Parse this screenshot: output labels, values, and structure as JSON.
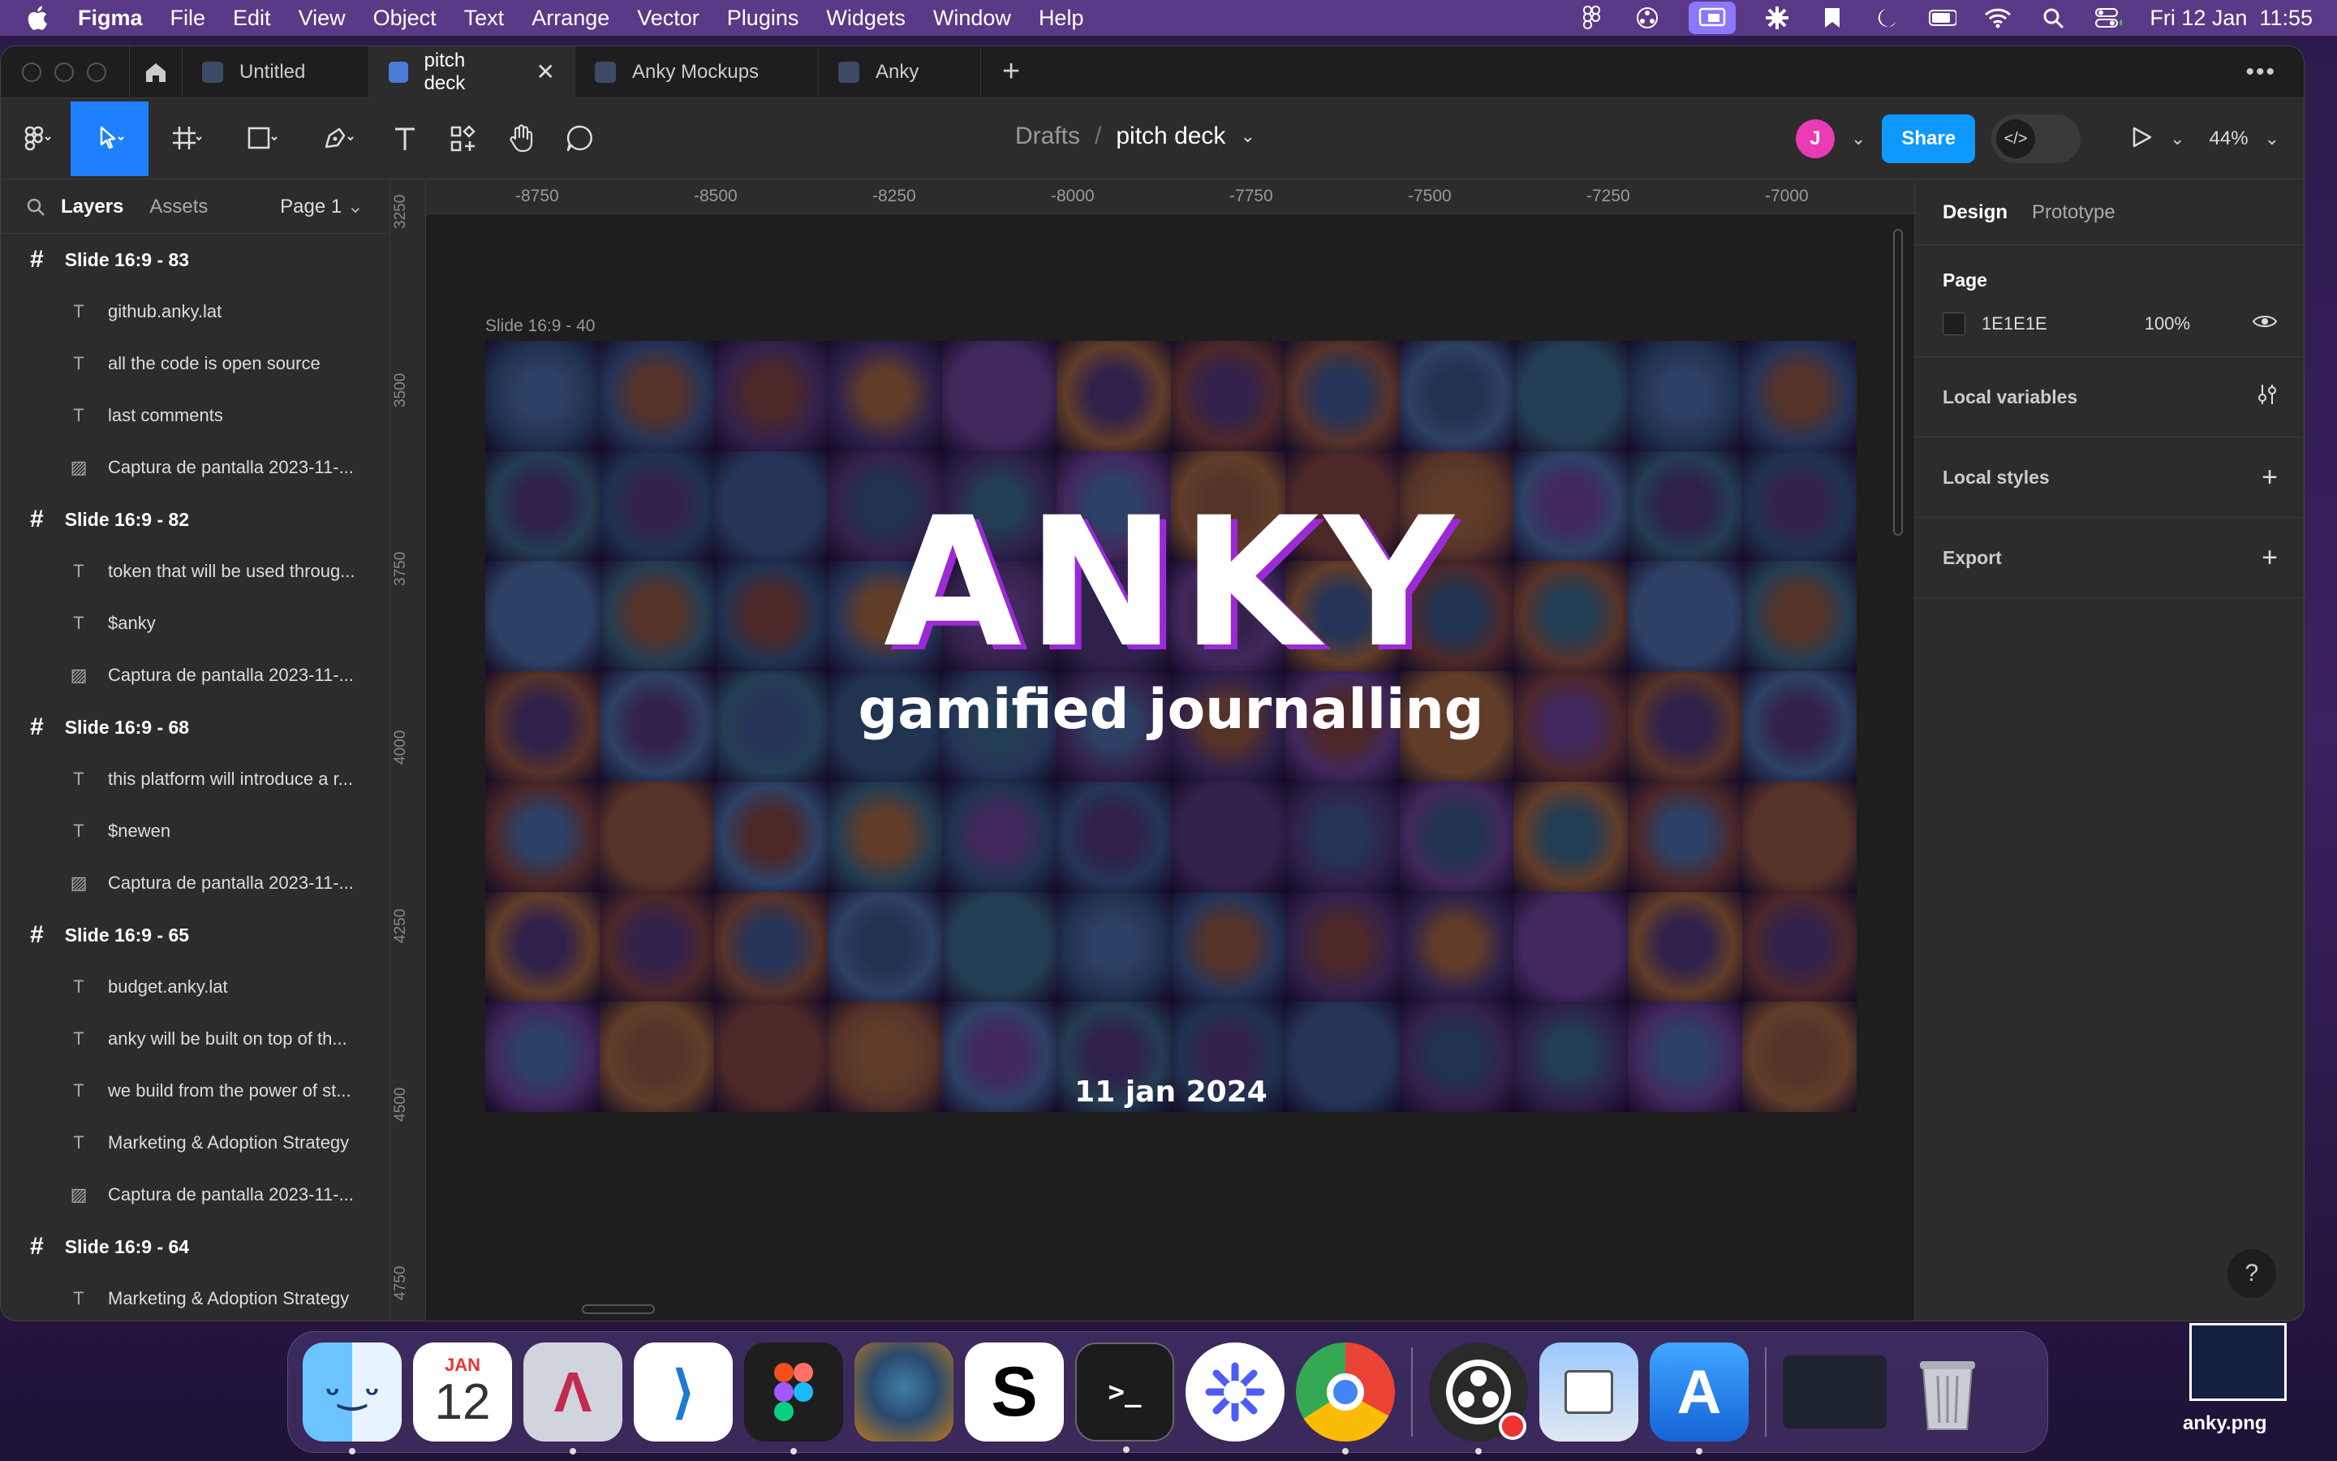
{
  "menubar": {
    "app": "Figma",
    "items": [
      "File",
      "Edit",
      "View",
      "Object",
      "Text",
      "Arrange",
      "Vector",
      "Plugins",
      "Widgets",
      "Window",
      "Help"
    ],
    "datetime": "Fri 12 Jan  11:55"
  },
  "tabs": [
    {
      "label": "Untitled"
    },
    {
      "label": "pitch deck"
    },
    {
      "label": "Anky Mockups"
    },
    {
      "label": "Anky"
    }
  ],
  "toolbar": {
    "breadcrumb_root": "Drafts",
    "breadcrumb_sep": "/",
    "file_name": "pitch deck",
    "avatar_initial": "J",
    "share_label": "Share",
    "zoom": "44%"
  },
  "layers_panel": {
    "tab_layers": "Layers",
    "tab_assets": "Assets",
    "page": "Page 1",
    "items": [
      {
        "type": "frame",
        "label": "Slide 16:9 - 83"
      },
      {
        "type": "text",
        "label": "github.anky.lat"
      },
      {
        "type": "text",
        "label": "all the code is open source"
      },
      {
        "type": "text",
        "label": "last comments"
      },
      {
        "type": "image",
        "label": "Captura de pantalla 2023-11-..."
      },
      {
        "type": "frame",
        "label": "Slide 16:9 - 82"
      },
      {
        "type": "text",
        "label": "token that will be used throug..."
      },
      {
        "type": "text",
        "label": "$anky"
      },
      {
        "type": "image",
        "label": "Captura de pantalla 2023-11-..."
      },
      {
        "type": "frame",
        "label": "Slide 16:9 - 68"
      },
      {
        "type": "text",
        "label": "this platform will introduce a r..."
      },
      {
        "type": "text",
        "label": "$newen"
      },
      {
        "type": "image",
        "label": "Captura de pantalla 2023-11-..."
      },
      {
        "type": "frame",
        "label": "Slide 16:9 - 65"
      },
      {
        "type": "text",
        "label": "budget.anky.lat"
      },
      {
        "type": "text",
        "label": "anky will be built on top of th..."
      },
      {
        "type": "text",
        "label": "we build from the power of st..."
      },
      {
        "type": "text",
        "label": "Marketing & Adoption Strategy"
      },
      {
        "type": "image",
        "label": "Captura de pantalla 2023-11-..."
      },
      {
        "type": "frame",
        "label": "Slide 16:9 - 64"
      },
      {
        "type": "text",
        "label": "Marketing & Adoption Strategy"
      }
    ]
  },
  "canvas": {
    "ruler_top": [
      "-8750",
      "-8500",
      "-8250",
      "-8000",
      "-7750",
      "-7500",
      "-7250",
      "-7000"
    ],
    "ruler_left": [
      "3250",
      "3500",
      "3750",
      "4000",
      "4250",
      "4500",
      "4750"
    ],
    "frame_label": "Slide 16:9 - 40",
    "slide_title": "ANKY",
    "slide_subtitle": "gamified journalling",
    "slide_date": "11 jan 2024"
  },
  "design_panel": {
    "tab_design": "Design",
    "tab_prototype": "Prototype",
    "page_section": "Page",
    "page_color": "1E1E1E",
    "page_opacity": "100%",
    "local_variables": "Local variables",
    "local_styles": "Local styles",
    "export": "Export",
    "help": "?"
  },
  "dock": {
    "calendar_month": "JAN",
    "calendar_day": "12",
    "desktop_file": "anky.png"
  },
  "colors": {
    "accent": "#0d99ff",
    "select_tool": "#1e80ff",
    "avatar": "#e93bb3",
    "title_shadow": "#9b2ad6"
  }
}
